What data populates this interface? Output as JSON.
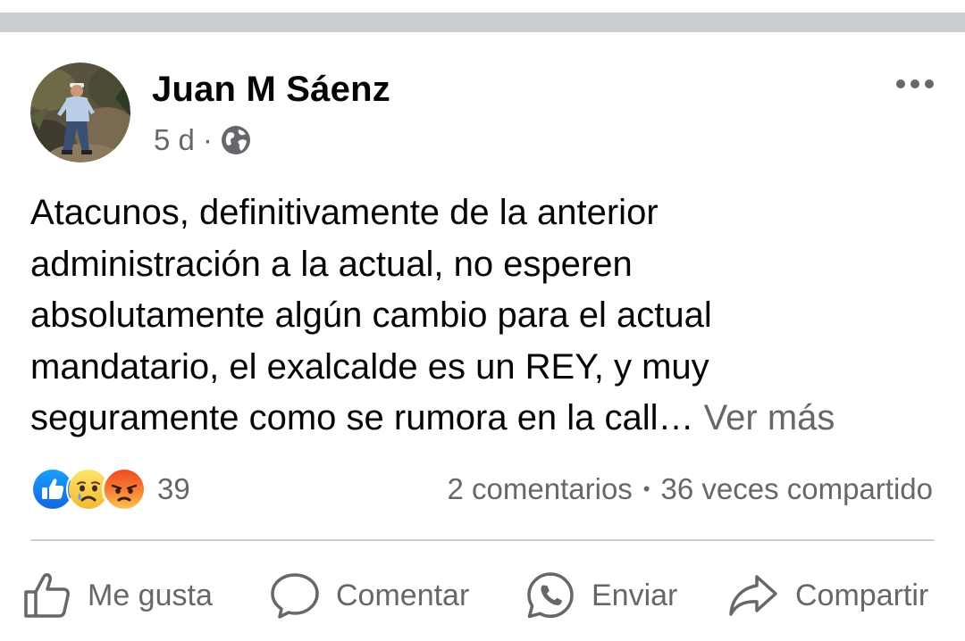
{
  "post": {
    "author_name": "Juan M Sáenz",
    "timestamp": "5 d",
    "meta_separator": "·",
    "audience_icon": "globe-icon",
    "more_icon": "more-horizontal-icon",
    "text_lines": [
      "Atacunos, definitivamente de la anterior",
      "administración a la actual, no esperen",
      "absolutamente algún cambio para el actual",
      "mandatario, el exalcalde es un REY, y muy",
      "seguramente como se rumora en la call… "
    ],
    "see_more_label": "Ver más"
  },
  "reactions": {
    "icons": [
      "like-reaction-icon",
      "sad-reaction-icon",
      "angry-reaction-icon"
    ],
    "count": "39"
  },
  "stats": {
    "comments": "2 comentarios",
    "separator": "•",
    "shares": "36 veces compartido"
  },
  "actions": {
    "like_label": "Me gusta",
    "comment_label": "Comentar",
    "send_label": "Enviar",
    "share_label": "Compartir"
  },
  "colors": {
    "text_primary": "#050505",
    "text_secondary": "#65676b",
    "like_blue": "#1877f2",
    "divider": "#ced0d4",
    "top_band": "#cacdd1"
  }
}
